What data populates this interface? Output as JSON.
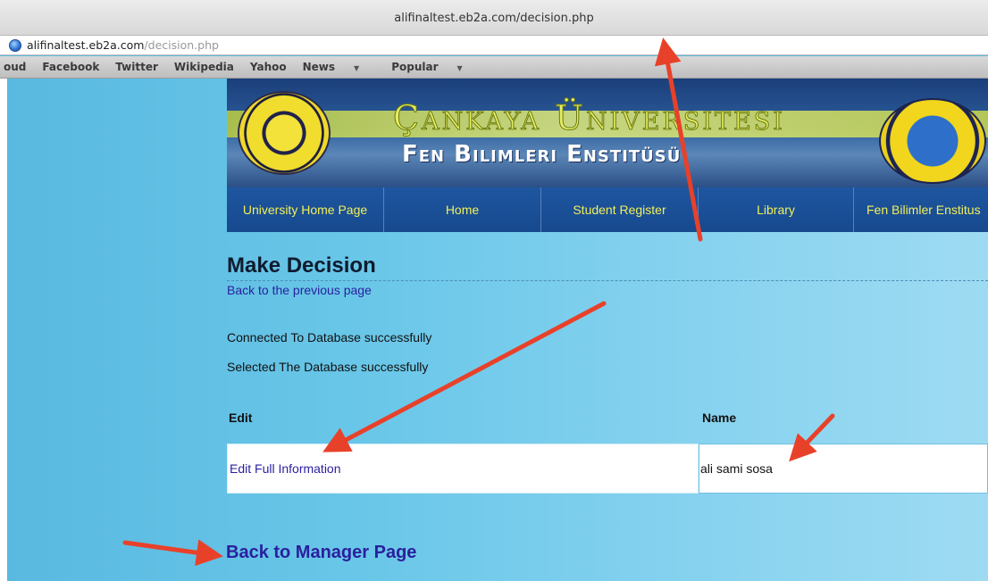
{
  "browser": {
    "window_title": "alifinaltest.eb2a.com/decision.php",
    "address_host": "alifinaltest.eb2a.com",
    "address_path": "/decision.php",
    "bookmarks": [
      "oud",
      "Facebook",
      "Twitter",
      "Wikipedia",
      "Yahoo",
      "News",
      "Popular"
    ]
  },
  "banner": {
    "title": "Çankaya Üniversitesi",
    "subtitle": "Fen Bilimleri Enstitüsü"
  },
  "nav": [
    "University Home Page",
    "Home",
    "Student Register",
    "Library",
    "Fen Bilimler Enstitus"
  ],
  "main": {
    "title": "Make Decision",
    "back_link": "Back to the previous page",
    "messages": [
      "Connected To Database successfully",
      "Selected The Database successfully"
    ],
    "table": {
      "headers": [
        "Edit",
        "Name"
      ],
      "rows": [
        [
          "Edit Full Information",
          "ali sami sosa"
        ]
      ]
    },
    "back_manager": "Back to Manager Page"
  },
  "annotation_color": "#e8412a"
}
